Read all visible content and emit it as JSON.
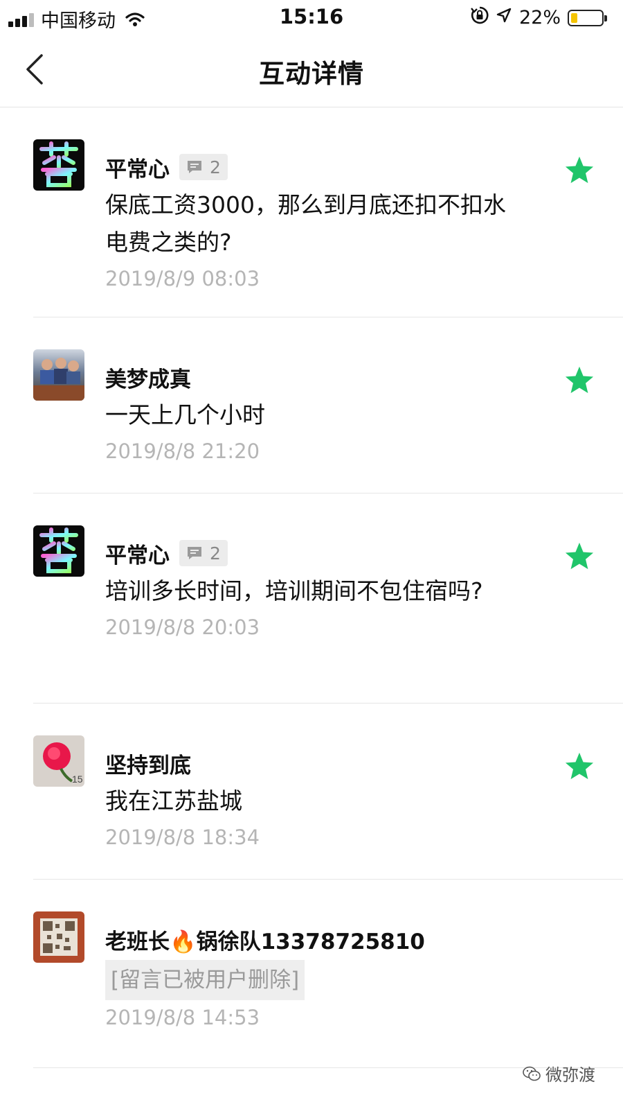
{
  "status_bar": {
    "carrier": "中国移动",
    "time": "15:16",
    "battery": "22%",
    "battery_fraction": 0.22,
    "icons": [
      "signal-icon",
      "wifi-icon",
      "orientation-lock-icon",
      "location-icon",
      "battery-icon"
    ]
  },
  "nav": {
    "title": "互动详情",
    "back_icon": "chevron-left-icon"
  },
  "colors": {
    "star": "#20c56a",
    "timestamp": "#b5b5b5",
    "badge_bg": "#ececec"
  },
  "comments": [
    {
      "name": "平常心",
      "reply_count": "2",
      "text": "保底工资3000，那么到月底还扣不扣水电费之类的?",
      "time": "2019/8/9 08:03"
    },
    {
      "name": "美梦成真",
      "text": "一天上几个小时",
      "time": "2019/8/8 21:20"
    },
    {
      "name": "平常心",
      "reply_count": "2",
      "text": "培训多长时间，培训期间不包住宿吗?",
      "time": "2019/8/8 20:03"
    },
    {
      "name": "坚持到底",
      "text": "我在江苏盐城",
      "time": "2019/8/8 18:34"
    },
    {
      "name": "老班长🔥锅徐队13378725810",
      "deleted_text": "[留言已被用户删除]",
      "time": "2019/8/8 14:53"
    }
  ],
  "watermark": {
    "text": "微弥渡",
    "icon": "wechat-icon"
  }
}
